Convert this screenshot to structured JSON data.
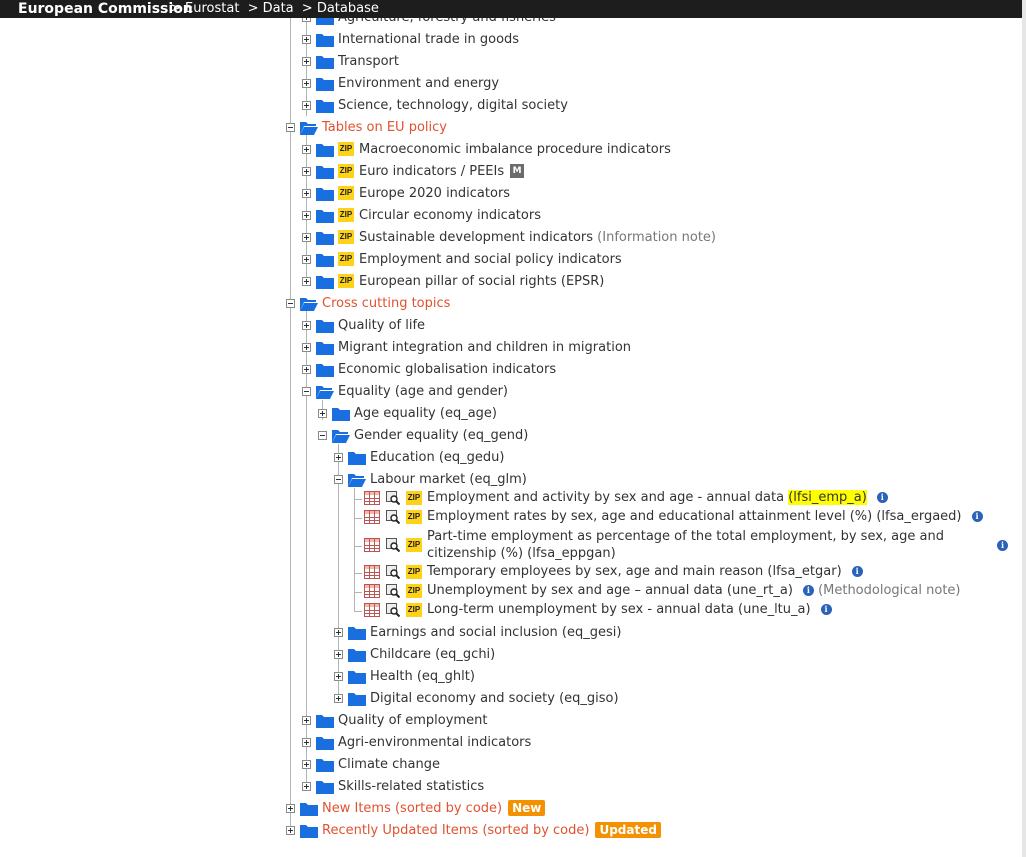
{
  "topbar": {
    "brand": "European Commission",
    "crumbs": [
      "> Eurostat",
      "> Data",
      "> Database"
    ]
  },
  "top_items": [
    "Agriculture, forestry and fisheries",
    "International trade in goods",
    "Transport",
    "Environment and energy",
    "Science, technology, digital society"
  ],
  "eu_policy": {
    "label": "Tables on EU policy",
    "items": [
      "Macroeconomic imbalance procedure indicators",
      "Euro indicators / PEEIs",
      "Europe 2020 indicators",
      "Circular economy indicators",
      "Sustainable development indicators",
      "Employment and social policy indicators",
      "European pillar of social rights (EPSR)"
    ],
    "m_badge": "M",
    "sdi_note": "(Information note)",
    "zip": "ZIP"
  },
  "cross_cutting": {
    "label": "Cross cutting topics",
    "items_before": [
      "Quality of life",
      "Migrant integration and children in migration",
      "Economic globalisation indicators"
    ],
    "equality": "Equality (age and gender)",
    "age_equality": "Age equality (eq_age)",
    "gender_equality": "Gender equality (eq_gend)",
    "education": "Education (eq_gedu)",
    "labour_market": "Labour market (eq_glm)",
    "datasets": [
      "Employment and activity by sex and age - annual data",
      "Employment rates by sex, age and educational attainment level (%) (lfsa_ergaed)",
      "Part-time employment as percentage of the total employment, by sex, age and citizenship (%) (lfsa_eppgan)",
      "Temporary employees by sex, age and main reason (lfsa_etgar)",
      "Unemployment by sex and age – annual data (une_rt_a)",
      "Long-term unemployment by sex - annual data (une_ltu_a)"
    ],
    "highlight_code": "(lfsi_emp_a)",
    "method_note": "(Methodological note)",
    "gender_after": [
      "Earnings and social inclusion (eq_gesi)",
      "Childcare (eq_gchi)",
      "Health (eq_ghlt)",
      "Digital economy and society (eq_giso)"
    ],
    "items_after": [
      "Quality of employment",
      "Agri-environmental indicators",
      "Climate change",
      "Skills-related statistics"
    ]
  },
  "new_items": {
    "label": "New Items (sorted by code)",
    "badge": "New"
  },
  "updated_items": {
    "label": "Recently Updated Items (sorted by code)",
    "badge": "Updated"
  },
  "info_glyph": "i",
  "colors": {
    "folder": "#1a6fe0",
    "red": "#e0522f",
    "zip": "#ffd21a",
    "badge": "#f39100",
    "info": "#2a62b8"
  }
}
